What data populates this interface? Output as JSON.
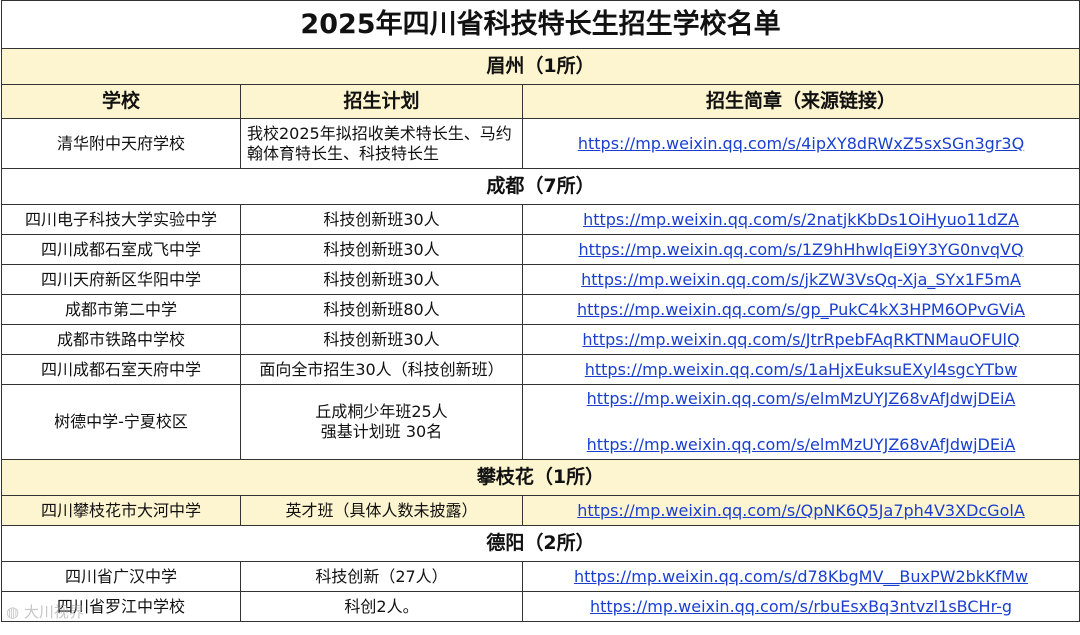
{
  "title": "2025年四川省科技特长生招生学校名单",
  "headers": {
    "school": "学校",
    "plan": "招生计划",
    "link": "招生简章（来源链接）"
  },
  "regions": [
    {
      "name": "眉州（1所）",
      "rows": [
        {
          "school": "清华附中天府学校",
          "plan": "我校2025年拟招收美术特长生、马约翰体育特长生、科技特长生",
          "links": [
            "https://mp.weixin.qq.com/s/4ipXY8dRWxZ5sxSGn3gr3Q"
          ]
        }
      ]
    },
    {
      "name": "成都（7所）",
      "rows": [
        {
          "school": "四川电子科技大学实验中学",
          "plan": "科技创新班30人",
          "links": [
            "https://mp.weixin.qq.com/s/2natjkKbDs1OiHyuo11dZA"
          ]
        },
        {
          "school": "四川成都石室成飞中学",
          "plan": "科技创新班30人",
          "links": [
            "https://mp.weixin.qq.com/s/1Z9hHhwlqEi9Y3YG0nvqVQ"
          ]
        },
        {
          "school": "四川天府新区华阳中学",
          "plan": "科技创新班30人",
          "links": [
            "https://mp.weixin.qq.com/s/jkZW3VsQq-Xja_SYx1F5mA"
          ]
        },
        {
          "school": "成都市第二中学",
          "plan": "科技创新班80人",
          "links": [
            "https://mp.weixin.qq.com/s/gp_PukC4kX3HPM6OPvGViA"
          ]
        },
        {
          "school": "成都市铁路中学校",
          "plan": "科技创新班30人",
          "links": [
            "https://mp.weixin.qq.com/s/JtrRpebFAqRKTNMauOFUlQ"
          ]
        },
        {
          "school": "四川成都石室天府中学",
          "plan": "面向全市招生30人（科技创新班）",
          "links": [
            "https://mp.weixin.qq.com/s/1aHjxEuksuEXyl4sgcYTbw"
          ]
        },
        {
          "school": "树德中学-宁夏校区",
          "plan_lines": [
            "丘成桐少年班25人",
            "强基计划班 30名"
          ],
          "links": [
            "https://mp.weixin.qq.com/s/elmMzUYJZ68vAfJdwjDEiA",
            "https://mp.weixin.qq.com/s/elmMzUYJZ68vAfJdwjDEiA"
          ]
        }
      ]
    },
    {
      "name": "攀枝花（1所）",
      "rows": [
        {
          "school": "四川攀枝花市大河中学",
          "plan": "英才班（具体人数未披露）",
          "links": [
            "https://mp.weixin.qq.com/s/QpNK6Q5Ja7ph4V3XDcGolA"
          ]
        }
      ]
    },
    {
      "name": "德阳（2所）",
      "rows": [
        {
          "school": "四川省广汉中学",
          "plan": "科技创新（27人）",
          "links": [
            "https://mp.weixin.qq.com/s/d78KbgMV__BuxPW2bkKfMw"
          ]
        },
        {
          "school": "四川省罗江中学校",
          "plan": "科创2人。",
          "links": [
            "https://mp.weixin.qq.com/s/rbuEsxBq3ntvzl1sBCHr-g"
          ]
        }
      ]
    }
  ],
  "watermark": "大川视界",
  "colors": {
    "yellow": "#fdf5cf",
    "link": "#1a3fcf",
    "border": "#333333"
  }
}
